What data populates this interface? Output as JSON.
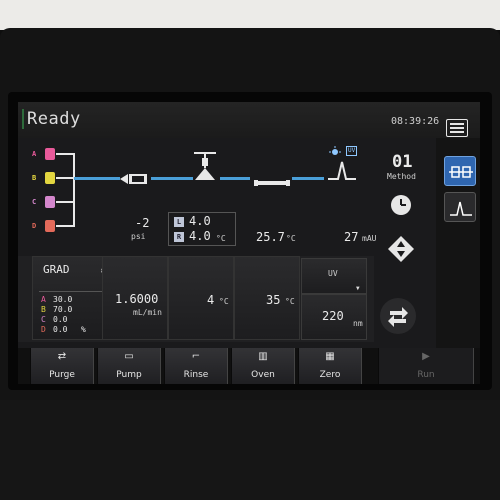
{
  "header": {
    "status": "Ready",
    "time": "08:39:26",
    "menu_icon": "list-menu-icon"
  },
  "solvents": [
    {
      "label": "A",
      "color": "#e85a9a"
    },
    {
      "label": "B",
      "color": "#e3d640"
    },
    {
      "label": "C",
      "color": "#d487cc"
    },
    {
      "label": "D",
      "color": "#e36a5a"
    }
  ],
  "flowpath": {
    "pressure": "-2",
    "pressure_unit": "psi",
    "left_label": "L",
    "right_label": "R",
    "left_temp": "4.0",
    "right_temp": "4.0",
    "sampler_unit": "°C",
    "column_temp": "25.7",
    "column_unit": "°C",
    "detector_signal": "27",
    "detector_unit": "mAU",
    "lamp_badge": "UV",
    "method_number": "01",
    "method_label": "Method"
  },
  "gradient": {
    "mode": "GRAD",
    "rows": [
      {
        "label": "A",
        "value": "30.0",
        "unit": ""
      },
      {
        "label": "B",
        "value": "70.0",
        "unit": ""
      },
      {
        "label": "C",
        "value": "0.0",
        "unit": ""
      },
      {
        "label": "D",
        "value": "0.0",
        "unit": "%"
      }
    ]
  },
  "settings": {
    "flow_value": "1.6000",
    "flow_unit": "mL/min",
    "sampler_temp": "4",
    "sampler_unit": "°C",
    "oven_temp": "35",
    "oven_unit": "°C",
    "detector_mode": "UV",
    "wavelength": "220",
    "wavelength_unit": "nm"
  },
  "toolbar": [
    {
      "icon": "purge-icon",
      "glyph": "⇄",
      "label": "Purge",
      "enabled": true
    },
    {
      "icon": "pump-icon",
      "glyph": "▭",
      "label": "Pump",
      "enabled": true
    },
    {
      "icon": "rinse-icon",
      "glyph": "⌐",
      "label": "Rinse",
      "enabled": true
    },
    {
      "icon": "oven-icon",
      "glyph": "▥",
      "label": "Oven",
      "enabled": true
    },
    {
      "icon": "zero-icon",
      "glyph": "▦",
      "label": "Zero",
      "enabled": true
    },
    {
      "icon": "run-icon",
      "glyph": "▶",
      "label": "Run",
      "enabled": false
    }
  ],
  "colors": {
    "flow_line": "#4a9fd8",
    "accent_blue": "#2f66b0",
    "status_green": "#2d6a3a"
  }
}
